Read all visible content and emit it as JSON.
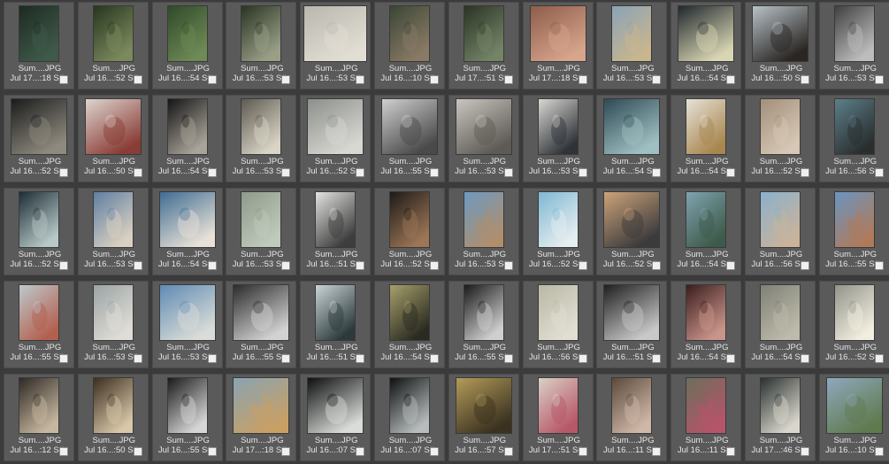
{
  "browser": {
    "thumbnails": [
      {
        "name": "Sum....JPG",
        "date": "Jul 17...:18 S#:",
        "subject": "leaf-icon",
        "tone": [
          "#1d2b22",
          "#3f5a4a"
        ],
        "shape": "portrait"
      },
      {
        "name": "Sum....JPG",
        "date": "Jul 16...:52 S#:",
        "subject": "woman-dress-icon",
        "tone": [
          "#27351f",
          "#7b8a5d"
        ],
        "shape": "portrait"
      },
      {
        "name": "Sum....JPG",
        "date": "Jul 16...:54 S#:",
        "subject": "spiral-icon",
        "tone": [
          "#2f4a2a",
          "#6e8a55"
        ],
        "shape": "portrait"
      },
      {
        "name": "Sum....JPG",
        "date": "Jul 16...:53 S#:",
        "subject": "woman-dress-icon",
        "tone": [
          "#2a3423",
          "#9aa088"
        ],
        "shape": "portrait"
      },
      {
        "name": "Sum....JPG",
        "date": "Jul 16...:53 S#:",
        "subject": "flowers-frame-icon",
        "tone": [
          "#b9b7ae",
          "#e2ded4"
        ],
        "shape": "landscape"
      },
      {
        "name": "Sum....JPG",
        "date": "Jul 16...:10 S#:",
        "subject": "legs-icon",
        "tone": [
          "#3a4636",
          "#8a7a65"
        ],
        "shape": "portrait"
      },
      {
        "name": "Sum....JPG",
        "date": "Jul 17...:51 S#:",
        "subject": "woman-icon",
        "tone": [
          "#2a3325",
          "#748466"
        ],
        "shape": "portrait"
      },
      {
        "name": "Sum....JPG",
        "date": "Jul 17...:18 S#:",
        "subject": "lips-icon",
        "tone": [
          "#8d5d4a",
          "#d7a48c"
        ],
        "shape": "square"
      },
      {
        "name": "Sum....JPG",
        "date": "Jul 16...:53 S#:",
        "subject": "cocktail-icon",
        "tone": [
          "#8aa3b8",
          "#c9b68d"
        ],
        "shape": "portrait"
      },
      {
        "name": "Sum....JPG",
        "date": "Jul 16...:54 S#:",
        "subject": "bag-icon",
        "tone": [
          "#20282e",
          "#d8d5b2"
        ],
        "shape": "square"
      },
      {
        "name": "Sum....JPG",
        "date": "Jul 16...:50 S#:",
        "subject": "profile-icon",
        "tone": [
          "#b8c2c8",
          "#2a2623"
        ],
        "shape": "square"
      },
      {
        "name": "Sum....JPG",
        "date": "Jul 16...:53 S#:",
        "subject": "shells-grid-icon",
        "tone": [
          "#404040",
          "#bdbdbd"
        ],
        "shape": "portrait"
      },
      {
        "name": "Sum....JPG",
        "date": "Jul 16...:52 S#:",
        "subject": "oyster-icon",
        "tone": [
          "#1a1c1c",
          "#8f8a7e"
        ],
        "shape": "square"
      },
      {
        "name": "Sum....JPG",
        "date": "Jul 16...:50 S#:",
        "subject": "starfish-icon",
        "tone": [
          "#ddd5ce",
          "#8a3c36"
        ],
        "shape": "square"
      },
      {
        "name": "Sum....JPG",
        "date": "Jul 16...:54 S#:",
        "subject": "shells-grid-icon",
        "tone": [
          "#151515",
          "#a9a39a"
        ],
        "shape": "portrait"
      },
      {
        "name": "Sum....JPG",
        "date": "Jul 16...:53 S#:",
        "subject": "nautilus-icon",
        "tone": [
          "#5d5a51",
          "#d9d4c5"
        ],
        "shape": "portrait"
      },
      {
        "name": "Sum....JPG",
        "date": "Jul 16...:52 S#:",
        "subject": "starfish-icon",
        "tone": [
          "#8c8f8a",
          "#d8d8d3"
        ],
        "shape": "square"
      },
      {
        "name": "Sum....JPG",
        "date": "Jul 16...:55 S#:",
        "subject": "shells-grid-icon",
        "tone": [
          "#cfcfcf",
          "#4a4a4a"
        ],
        "shape": "square"
      },
      {
        "name": "Sum....JPG",
        "date": "Jul 16...:53 S#:",
        "subject": "shell-icon",
        "tone": [
          "#c9c6c0",
          "#5e5a55"
        ],
        "shape": "square"
      },
      {
        "name": "Sum....JPG",
        "date": "Jul 16...:53 S#:",
        "subject": "hair-comb-icon",
        "tone": [
          "#d8d7d2",
          "#2f3338"
        ],
        "shape": "portrait"
      },
      {
        "name": "Sum....JPG",
        "date": "Jul 16...:54 S#:",
        "subject": "water-shell-icon",
        "tone": [
          "#2f4a55",
          "#9fc0c3"
        ],
        "shape": "square"
      },
      {
        "name": "Sum....JPG",
        "date": "Jul 16...:54 S#:",
        "subject": "fish-icon",
        "tone": [
          "#e6e2d9",
          "#a8874f"
        ],
        "shape": "portrait"
      },
      {
        "name": "Sum....JPG",
        "date": "Jul 16...:52 S#:",
        "subject": "spiral-icon",
        "tone": [
          "#a28f7a",
          "#d6c8b5"
        ],
        "shape": "portrait"
      },
      {
        "name": "Sum....JPG",
        "date": "Jul 16...:56 S#:",
        "subject": "stones-icon",
        "tone": [
          "#5c7f8a",
          "#2a2e2e"
        ],
        "shape": "portrait"
      },
      {
        "name": "Sum....JPG",
        "date": "Jul 16...:52 S#:",
        "subject": "sea-sparkle-icon",
        "tone": [
          "#1d2d35",
          "#b7c8c8"
        ],
        "shape": "portrait"
      },
      {
        "name": "Sum....JPG",
        "date": "Jul 16...:53 S#:",
        "subject": "woman-dress-icon",
        "tone": [
          "#5f7ea3",
          "#d9d0c0"
        ],
        "shape": "portrait"
      },
      {
        "name": "Sum....JPG",
        "date": "Jul 16...:54 S#:",
        "subject": "shell-icon",
        "tone": [
          "#3f6c92",
          "#e8e1d7"
        ],
        "shape": "square"
      },
      {
        "name": "Sum....JPG",
        "date": "Jul 16...:53 S#:",
        "subject": "table-glasses-icon",
        "tone": [
          "#8f9a8a",
          "#c0cabc"
        ],
        "shape": "portrait"
      },
      {
        "name": "Sum....JPG",
        "date": "Jul 16...:51 S#:",
        "subject": "woman-dress-icon",
        "tone": [
          "#e3e3e1",
          "#3d3d3d"
        ],
        "shape": "portrait"
      },
      {
        "name": "Sum....JPG",
        "date": "Jul 16...:52 S#:",
        "subject": "hat-woman-icon",
        "tone": [
          "#1e1a17",
          "#9c7656"
        ],
        "shape": "portrait"
      },
      {
        "name": "Sum....JPG",
        "date": "Jul 16...:53 S#:",
        "subject": "hat-woman-icon",
        "tone": [
          "#6d9ac1",
          "#b08e6c"
        ],
        "shape": "portrait"
      },
      {
        "name": "Sum....JPG",
        "date": "Jul 16...:52 S#:",
        "subject": "sea-icon",
        "tone": [
          "#7fb7d3",
          "#e6eef0"
        ],
        "shape": "portrait"
      },
      {
        "name": "Sum....JPG",
        "date": "Jul 16...:52 S#:",
        "subject": "couple-icon",
        "tone": [
          "#cda37a",
          "#3b3a3c"
        ],
        "shape": "square"
      },
      {
        "name": "Sum....JPG",
        "date": "Jul 16...:54 S#:",
        "subject": "woman-dress-icon",
        "tone": [
          "#7fa3b0",
          "#3e5a4a"
        ],
        "shape": "portrait"
      },
      {
        "name": "Sum....JPG",
        "date": "Jul 16...:56 S#:",
        "subject": "rocks-icon",
        "tone": [
          "#8ab1cc",
          "#c9b39b"
        ],
        "shape": "portrait"
      },
      {
        "name": "Sum....JPG",
        "date": "Jul 16...:55 S#:",
        "subject": "rocks-icon",
        "tone": [
          "#6a95c0",
          "#b07a5a"
        ],
        "shape": "portrait"
      },
      {
        "name": "Sum....JPG",
        "date": "Jul 16...:55 S#:",
        "subject": "swimsuits-icon",
        "tone": [
          "#bcc9cd",
          "#b4604e"
        ],
        "shape": "portrait"
      },
      {
        "name": "Sum....JPG",
        "date": "Jul 16...:53 S#:",
        "subject": "woman-dress-icon",
        "tone": [
          "#9aa3a4",
          "#e0ddd6"
        ],
        "shape": "portrait"
      },
      {
        "name": "Sum....JPG",
        "date": "Jul 16...:53 S#:",
        "subject": "laundry-icon",
        "tone": [
          "#5f8bb5",
          "#d9dcd7"
        ],
        "shape": "square"
      },
      {
        "name": "Sum....JPG",
        "date": "Jul 16...:55 S#:",
        "subject": "woman-dress-icon",
        "tone": [
          "#2c2c2c",
          "#d2d2d2"
        ],
        "shape": "square"
      },
      {
        "name": "Sum....JPG",
        "date": "Jul 16...:51 S#:",
        "subject": "sea-rocks-icon",
        "tone": [
          "#c9d4d6",
          "#2d3a3c"
        ],
        "shape": "portrait"
      },
      {
        "name": "Sum....JPG",
        "date": "Jul 16...:54 S#:",
        "subject": "silhouette-icon",
        "tone": [
          "#a6a06a",
          "#2b2a22"
        ],
        "shape": "portrait"
      },
      {
        "name": "Sum....JPG",
        "date": "Jul 16...:55 S#:",
        "subject": "camera-icon",
        "tone": [
          "#1a1a1a",
          "#cfcfcf"
        ],
        "shape": "portrait"
      },
      {
        "name": "Sum....JPG",
        "date": "Jul 16...:56 S#:",
        "subject": "bathroom-icon",
        "tone": [
          "#b9b8a6",
          "#e0dfd2"
        ],
        "shape": "portrait"
      },
      {
        "name": "Sum....JPG",
        "date": "Jul 16...:51 S#:",
        "subject": "face-glass-icon",
        "tone": [
          "#202020",
          "#c8c8c8"
        ],
        "shape": "square"
      },
      {
        "name": "Sum....JPG",
        "date": "Jul 16...:54 S#:",
        "subject": "face-icon",
        "tone": [
          "#3b1d1d",
          "#c9948a"
        ],
        "shape": "portrait"
      },
      {
        "name": "Sum....JPG",
        "date": "Jul 16...:54 S#:",
        "subject": "stick-icon",
        "tone": [
          "#7f8075",
          "#bdbbab"
        ],
        "shape": "portrait"
      },
      {
        "name": "Sum....JPG",
        "date": "Jul 16...:52 S#:",
        "subject": "flower-vase-icon",
        "tone": [
          "#93938a",
          "#f1eedf"
        ],
        "shape": "portrait"
      },
      {
        "name": "Sum....JPG",
        "date": "Jul 16...:12 S#:",
        "subject": "checker-icon",
        "tone": [
          "#2e2a25",
          "#c7b79f"
        ],
        "shape": "portrait"
      },
      {
        "name": "Sum....JPG",
        "date": "Jul 16...:50 S#:",
        "subject": "cake-stand-icon",
        "tone": [
          "#3c2e20",
          "#d8c7a8"
        ],
        "shape": "portrait"
      },
      {
        "name": "Sum....JPG",
        "date": "Jul 16...:55 S#:",
        "subject": "eye-icon",
        "tone": [
          "#1a1a1a",
          "#d6d6d6"
        ],
        "shape": "portrait"
      },
      {
        "name": "Sum....JPG",
        "date": "Jul 17...:18 S#:",
        "subject": "field-woman-icon",
        "tone": [
          "#8aa3b2",
          "#c9a064"
        ],
        "shape": "square"
      },
      {
        "name": "Sum....JPG",
        "date": "Jul 16...:07 S#:",
        "subject": "water-drops-icon",
        "tone": [
          "#0d0f10",
          "#d9dcd8"
        ],
        "shape": "square"
      },
      {
        "name": "Sum....JPG",
        "date": "Jul 16...:07 S#:",
        "subject": "water-drops-icon",
        "tone": [
          "#0e1112",
          "#b7bcbc"
        ],
        "shape": "portrait"
      },
      {
        "name": "Sum....JPG",
        "date": "Jul 16...:57 S#:",
        "subject": "couple-icon",
        "tone": [
          "#b39b5a",
          "#3a3120"
        ],
        "shape": "square"
      },
      {
        "name": "Sum....JPG",
        "date": "Jul 17...:51 S#:",
        "subject": "flowers-icon",
        "tone": [
          "#d9d0c5",
          "#b75768"
        ],
        "shape": "portrait"
      },
      {
        "name": "Sum....JPG",
        "date": "Jul 16...:11 S#:",
        "subject": "bouquet-icon",
        "tone": [
          "#5a4a3c",
          "#d0b8a8"
        ],
        "shape": "portrait"
      },
      {
        "name": "Sum....JPG",
        "date": "Jul 16...:11 S#:",
        "subject": "picnic-icon",
        "tone": [
          "#6b6f5a",
          "#b6546a"
        ],
        "shape": "portrait"
      },
      {
        "name": "Sum....JPG",
        "date": "Jul 17...:46 S#:",
        "subject": "plates-icon",
        "tone": [
          "#2a3130",
          "#d9d6cc"
        ],
        "shape": "portrait"
      },
      {
        "name": "Sum....JPG",
        "date": "Jul 16...:10 S#:",
        "subject": "landscape-icon",
        "tone": [
          "#8fa8bd",
          "#5f7a4f"
        ],
        "shape": "square"
      }
    ]
  }
}
